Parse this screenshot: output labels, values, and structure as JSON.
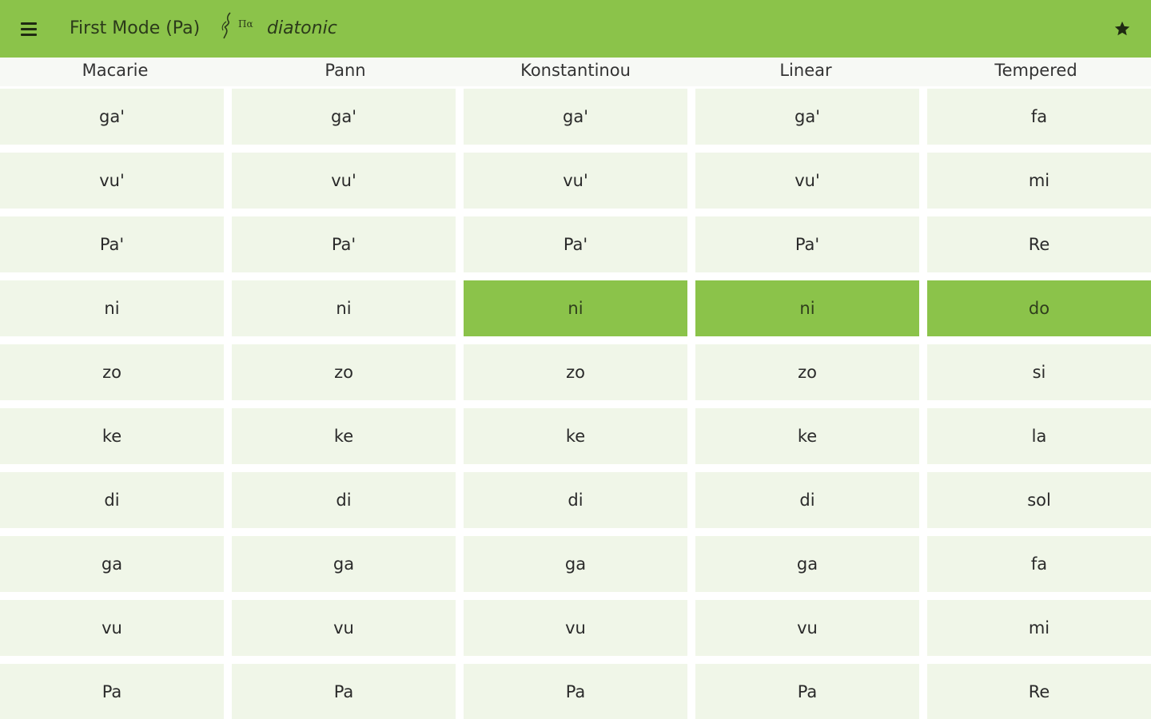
{
  "toolbar": {
    "title": "First Mode (Pa)",
    "mode_symbol_icon": "first-mode-neume-icon",
    "subtitle": "diatonic",
    "menu_icon": "hamburger-menu-icon",
    "favorite_icon": "star-icon",
    "background_color": "#8bc34a"
  },
  "columns": [
    "Macarie",
    "Pann",
    "Konstantinou",
    "Linear",
    "Tempered"
  ],
  "rows": [
    {
      "cells": [
        "ga'",
        "ga'",
        "ga'",
        "ga'",
        "fa"
      ],
      "active": [
        false,
        false,
        false,
        false,
        false
      ]
    },
    {
      "cells": [
        "vu'",
        "vu'",
        "vu'",
        "vu'",
        "mi"
      ],
      "active": [
        false,
        false,
        false,
        false,
        false
      ]
    },
    {
      "cells": [
        "Pa'",
        "Pa'",
        "Pa'",
        "Pa'",
        "Re"
      ],
      "active": [
        false,
        false,
        false,
        false,
        false
      ]
    },
    {
      "cells": [
        "ni",
        "ni",
        "ni",
        "ni",
        "do"
      ],
      "active": [
        false,
        false,
        true,
        true,
        true
      ]
    },
    {
      "cells": [
        "zo",
        "zo",
        "zo",
        "zo",
        "si"
      ],
      "active": [
        false,
        false,
        false,
        false,
        false
      ]
    },
    {
      "cells": [
        "ke",
        "ke",
        "ke",
        "ke",
        "la"
      ],
      "active": [
        false,
        false,
        false,
        false,
        false
      ]
    },
    {
      "cells": [
        "di",
        "di",
        "di",
        "di",
        "sol"
      ],
      "active": [
        false,
        false,
        false,
        false,
        false
      ]
    },
    {
      "cells": [
        "ga",
        "ga",
        "ga",
        "ga",
        "fa"
      ],
      "active": [
        false,
        false,
        false,
        false,
        false
      ]
    },
    {
      "cells": [
        "vu",
        "vu",
        "vu",
        "vu",
        "mi"
      ],
      "active": [
        false,
        false,
        false,
        false,
        false
      ]
    },
    {
      "cells": [
        "Pa",
        "Pa",
        "Pa",
        "Pa",
        "Re"
      ],
      "active": [
        false,
        false,
        false,
        false,
        false
      ]
    }
  ],
  "colors": {
    "accent": "#8bc34a",
    "cell_background": "#f0f6e8",
    "header_background": "#f7f9f5"
  }
}
